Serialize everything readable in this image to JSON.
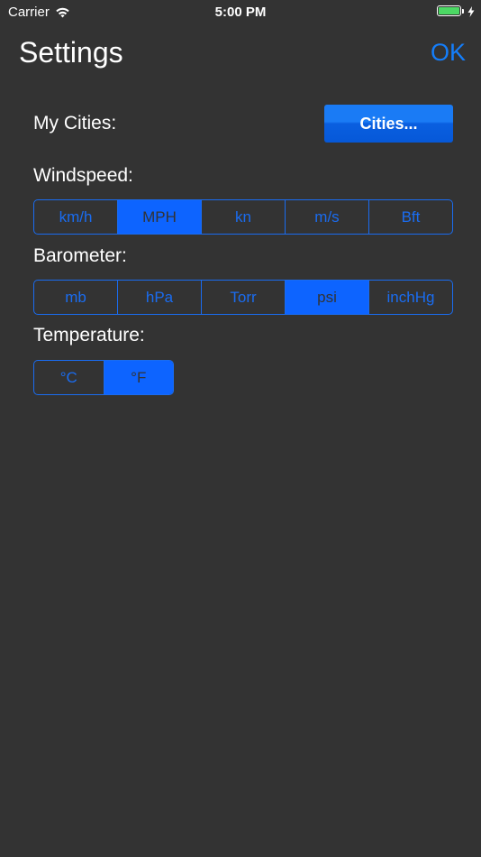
{
  "status_bar": {
    "carrier": "Carrier",
    "time": "5:00 PM",
    "battery_level": 1.0,
    "charging": true
  },
  "header": {
    "title": "Settings",
    "ok_label": "OK"
  },
  "cities": {
    "label": "My Cities:",
    "button_label": "Cities..."
  },
  "windspeed": {
    "label": "Windspeed:",
    "options": [
      "km/h",
      "MPH",
      "kn",
      "m/s",
      "Bft"
    ],
    "selected": "MPH"
  },
  "barometer": {
    "label": "Barometer:",
    "options": [
      "mb",
      "hPa",
      "Torr",
      "psi",
      "inchHg"
    ],
    "selected": "psi"
  },
  "temperature": {
    "label": "Temperature:",
    "options": [
      "°C",
      "°F"
    ],
    "selected": "°F"
  },
  "colors": {
    "background": "#333333",
    "accent": "#147efb",
    "segment_selected": "#0d64ff",
    "battery": "#4cd964"
  },
  "icons": {
    "wifi": "wifi-icon",
    "charging": "bolt-icon"
  }
}
